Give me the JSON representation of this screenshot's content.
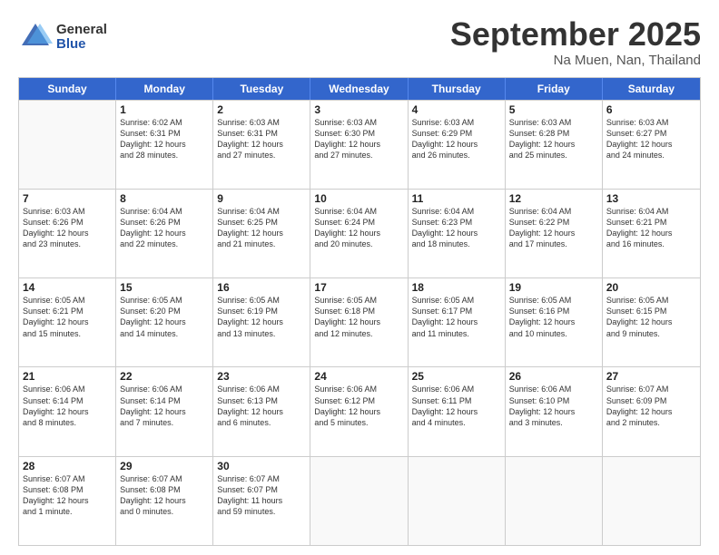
{
  "logo": {
    "general": "General",
    "blue": "Blue"
  },
  "title": "September 2025",
  "location": "Na Muen, Nan, Thailand",
  "weekdays": [
    "Sunday",
    "Monday",
    "Tuesday",
    "Wednesday",
    "Thursday",
    "Friday",
    "Saturday"
  ],
  "weeks": [
    [
      {
        "day": "",
        "info": ""
      },
      {
        "day": "1",
        "info": "Sunrise: 6:02 AM\nSunset: 6:31 PM\nDaylight: 12 hours\nand 28 minutes."
      },
      {
        "day": "2",
        "info": "Sunrise: 6:03 AM\nSunset: 6:31 PM\nDaylight: 12 hours\nand 27 minutes."
      },
      {
        "day": "3",
        "info": "Sunrise: 6:03 AM\nSunset: 6:30 PM\nDaylight: 12 hours\nand 27 minutes."
      },
      {
        "day": "4",
        "info": "Sunrise: 6:03 AM\nSunset: 6:29 PM\nDaylight: 12 hours\nand 26 minutes."
      },
      {
        "day": "5",
        "info": "Sunrise: 6:03 AM\nSunset: 6:28 PM\nDaylight: 12 hours\nand 25 minutes."
      },
      {
        "day": "6",
        "info": "Sunrise: 6:03 AM\nSunset: 6:27 PM\nDaylight: 12 hours\nand 24 minutes."
      }
    ],
    [
      {
        "day": "7",
        "info": "Sunrise: 6:03 AM\nSunset: 6:26 PM\nDaylight: 12 hours\nand 23 minutes."
      },
      {
        "day": "8",
        "info": "Sunrise: 6:04 AM\nSunset: 6:26 PM\nDaylight: 12 hours\nand 22 minutes."
      },
      {
        "day": "9",
        "info": "Sunrise: 6:04 AM\nSunset: 6:25 PM\nDaylight: 12 hours\nand 21 minutes."
      },
      {
        "day": "10",
        "info": "Sunrise: 6:04 AM\nSunset: 6:24 PM\nDaylight: 12 hours\nand 20 minutes."
      },
      {
        "day": "11",
        "info": "Sunrise: 6:04 AM\nSunset: 6:23 PM\nDaylight: 12 hours\nand 18 minutes."
      },
      {
        "day": "12",
        "info": "Sunrise: 6:04 AM\nSunset: 6:22 PM\nDaylight: 12 hours\nand 17 minutes."
      },
      {
        "day": "13",
        "info": "Sunrise: 6:04 AM\nSunset: 6:21 PM\nDaylight: 12 hours\nand 16 minutes."
      }
    ],
    [
      {
        "day": "14",
        "info": "Sunrise: 6:05 AM\nSunset: 6:21 PM\nDaylight: 12 hours\nand 15 minutes."
      },
      {
        "day": "15",
        "info": "Sunrise: 6:05 AM\nSunset: 6:20 PM\nDaylight: 12 hours\nand 14 minutes."
      },
      {
        "day": "16",
        "info": "Sunrise: 6:05 AM\nSunset: 6:19 PM\nDaylight: 12 hours\nand 13 minutes."
      },
      {
        "day": "17",
        "info": "Sunrise: 6:05 AM\nSunset: 6:18 PM\nDaylight: 12 hours\nand 12 minutes."
      },
      {
        "day": "18",
        "info": "Sunrise: 6:05 AM\nSunset: 6:17 PM\nDaylight: 12 hours\nand 11 minutes."
      },
      {
        "day": "19",
        "info": "Sunrise: 6:05 AM\nSunset: 6:16 PM\nDaylight: 12 hours\nand 10 minutes."
      },
      {
        "day": "20",
        "info": "Sunrise: 6:05 AM\nSunset: 6:15 PM\nDaylight: 12 hours\nand 9 minutes."
      }
    ],
    [
      {
        "day": "21",
        "info": "Sunrise: 6:06 AM\nSunset: 6:14 PM\nDaylight: 12 hours\nand 8 minutes."
      },
      {
        "day": "22",
        "info": "Sunrise: 6:06 AM\nSunset: 6:14 PM\nDaylight: 12 hours\nand 7 minutes."
      },
      {
        "day": "23",
        "info": "Sunrise: 6:06 AM\nSunset: 6:13 PM\nDaylight: 12 hours\nand 6 minutes."
      },
      {
        "day": "24",
        "info": "Sunrise: 6:06 AM\nSunset: 6:12 PM\nDaylight: 12 hours\nand 5 minutes."
      },
      {
        "day": "25",
        "info": "Sunrise: 6:06 AM\nSunset: 6:11 PM\nDaylight: 12 hours\nand 4 minutes."
      },
      {
        "day": "26",
        "info": "Sunrise: 6:06 AM\nSunset: 6:10 PM\nDaylight: 12 hours\nand 3 minutes."
      },
      {
        "day": "27",
        "info": "Sunrise: 6:07 AM\nSunset: 6:09 PM\nDaylight: 12 hours\nand 2 minutes."
      }
    ],
    [
      {
        "day": "28",
        "info": "Sunrise: 6:07 AM\nSunset: 6:08 PM\nDaylight: 12 hours\nand 1 minute."
      },
      {
        "day": "29",
        "info": "Sunrise: 6:07 AM\nSunset: 6:08 PM\nDaylight: 12 hours\nand 0 minutes."
      },
      {
        "day": "30",
        "info": "Sunrise: 6:07 AM\nSunset: 6:07 PM\nDaylight: 11 hours\nand 59 minutes."
      },
      {
        "day": "",
        "info": ""
      },
      {
        "day": "",
        "info": ""
      },
      {
        "day": "",
        "info": ""
      },
      {
        "day": "",
        "info": ""
      }
    ]
  ]
}
